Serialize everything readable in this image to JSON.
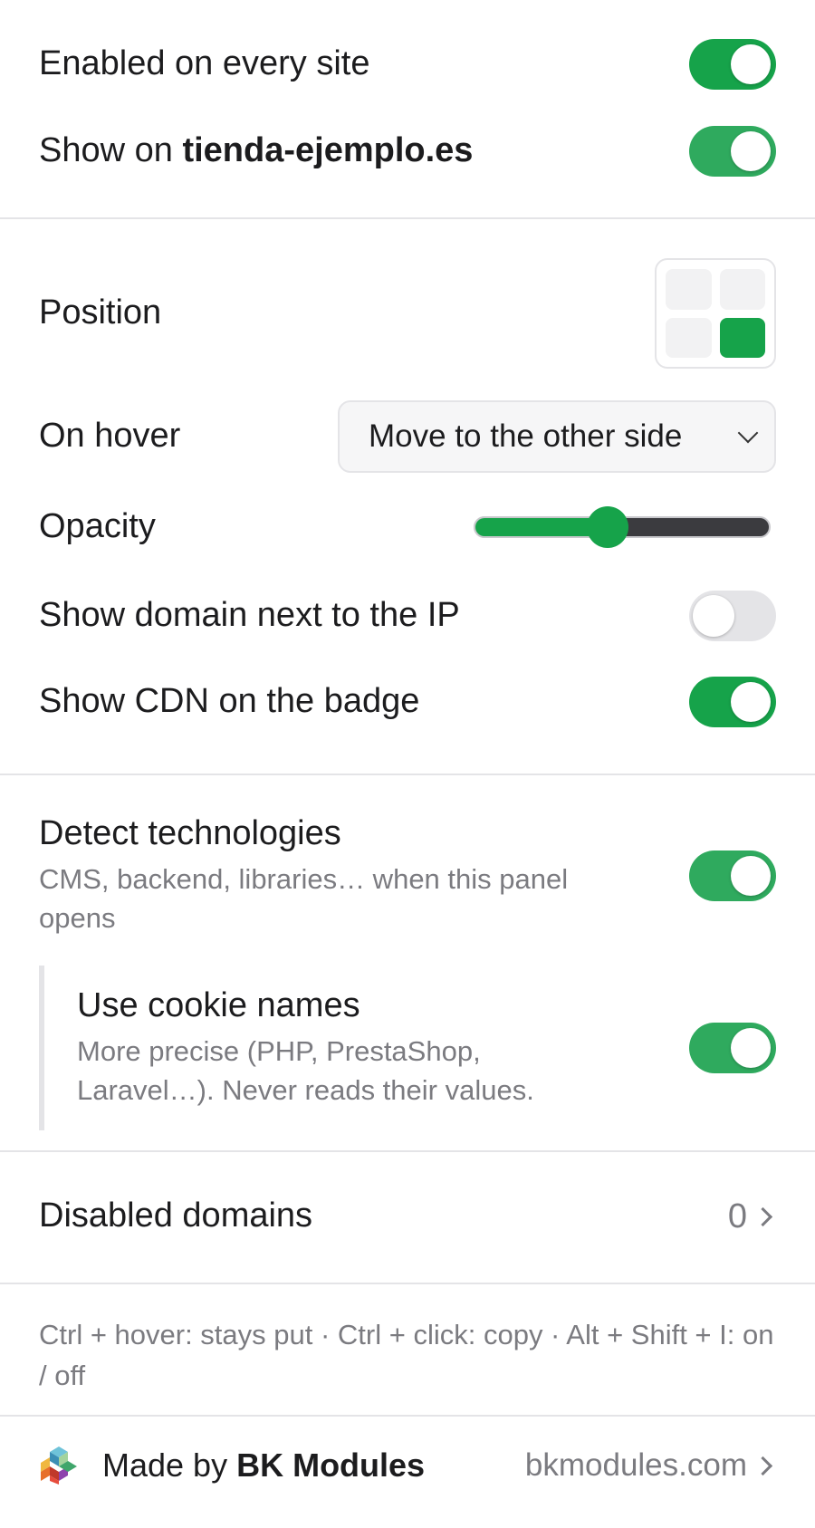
{
  "general": {
    "enabled_label": "Enabled on every site",
    "enabled": true,
    "show_on_prefix": "Show on ",
    "show_on_domain": "tienda-ejemplo.es",
    "show_on_enabled": true
  },
  "appearance": {
    "position_label": "Position",
    "position_selected": "bottom-right",
    "on_hover_label": "On hover",
    "on_hover_value": "Move to the other side",
    "opacity_label": "Opacity",
    "opacity_value": 0.45,
    "show_domain_label": "Show domain next to the IP",
    "show_domain_enabled": false,
    "show_cdn_label": "Show CDN on the badge",
    "show_cdn_enabled": true
  },
  "detection": {
    "detect_label": "Detect technologies",
    "detect_desc": "CMS, backend, libraries… when this panel opens",
    "detect_enabled": true,
    "cookie_label": "Use cookie names",
    "cookie_desc": "More precise (PHP, PrestaShop, Laravel…). Never reads their values.",
    "cookie_enabled": true
  },
  "disabled_domains": {
    "label": "Disabled domains",
    "count": "0"
  },
  "shortcuts_hint": "Ctrl + hover: stays put · Ctrl + click: copy · Alt + Shift + I: on / off",
  "footer": {
    "made_by_prefix": "Made by ",
    "made_by_name": "BK Modules",
    "site": "bkmodules.com"
  },
  "colors": {
    "accent": "#16a34a",
    "muted_text": "#7b7b80",
    "divider": "#e4e4e7"
  }
}
